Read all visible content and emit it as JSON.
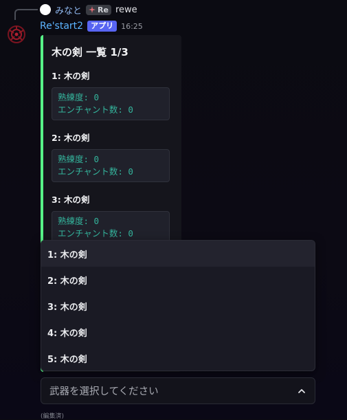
{
  "reply": {
    "username": "みなと",
    "badge_label": "Re",
    "text": "rewe"
  },
  "message": {
    "bot_name": "Re'start2",
    "app_tag": "アプリ",
    "time": "16:25",
    "edited_label": "(編集済)"
  },
  "embed": {
    "title": "木の剣 一覧 1/3",
    "accent_color": "#57f287",
    "fields": [
      {
        "name": "1: 木の剣",
        "proficiency": "熟練度: 0",
        "enchant": "エンチャント数: 0"
      },
      {
        "name": "2: 木の剣",
        "proficiency": "熟練度: 0",
        "enchant": "エンチャント数: 0"
      },
      {
        "name": "3: 木の剣",
        "proficiency": "熟練度: 0",
        "enchant": "エンチャント数: 0"
      }
    ]
  },
  "dropdown": {
    "options": [
      "1: 木の剣",
      "2: 木の剣",
      "3: 木の剣",
      "4: 木の剣",
      "5: 木の剣"
    ]
  },
  "select": {
    "placeholder": "武器を選択してください",
    "icon": "chevron-up-icon"
  },
  "colors": {
    "bot_name": "#5cb4ff",
    "app_tag_bg": "#5865f2",
    "code_text": "#34b39b"
  }
}
